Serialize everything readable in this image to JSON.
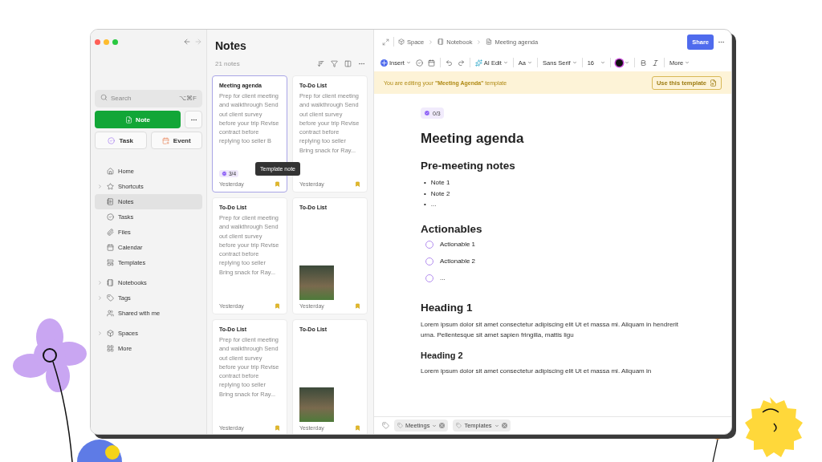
{
  "sidebar": {
    "search": {
      "placeholder": "Search",
      "shortcut": "⌥⌘F"
    },
    "note_button": "Note",
    "task_button": "Task",
    "event_button": "Event",
    "sections": [
      {
        "items": [
          {
            "label": "Home",
            "expandable": false,
            "selected": false
          },
          {
            "label": "Shortcuts",
            "expandable": true,
            "selected": false
          },
          {
            "label": "Notes",
            "expandable": false,
            "selected": true
          },
          {
            "label": "Tasks",
            "expandable": false,
            "selected": false
          },
          {
            "label": "Files",
            "expandable": false,
            "selected": false
          },
          {
            "label": "Calendar",
            "expandable": false,
            "selected": false
          },
          {
            "label": "Templates",
            "expandable": false,
            "selected": false
          }
        ]
      },
      {
        "items": [
          {
            "label": "Notebooks",
            "expandable": true,
            "selected": false
          },
          {
            "label": "Tags",
            "expandable": true,
            "selected": false
          },
          {
            "label": "Shared with me",
            "expandable": false,
            "selected": false
          }
        ]
      },
      {
        "items": [
          {
            "label": "Spaces",
            "expandable": true,
            "selected": false
          },
          {
            "label": "More",
            "expandable": false,
            "selected": false
          }
        ]
      }
    ]
  },
  "notes": {
    "title": "Notes",
    "count": "21 notes",
    "tooltip": "Template note",
    "cards": [
      {
        "title": "Meeting agenda",
        "preview": "Prep for client meeting and walkthrough Send out client survey before your trip Revise contract before replying too seller B",
        "image": false,
        "tasks": "3/4",
        "date": "Yesterday",
        "selected": true
      },
      {
        "title": "To-Do List",
        "preview": "Prep for client meeting and walkthrough Send out client survey before your trip Revise contract before replying too seller Bring snack for Ray...",
        "image": false,
        "date": "Yesterday",
        "selected": false
      },
      {
        "title": "To-Do List",
        "preview": "Prep for client meeting and walkthrough Send out client survey before your trip Revise contract before replying too seller Bring snack for Ray...",
        "image": false,
        "date": "Yesterday",
        "selected": false
      },
      {
        "title": "To-Do List",
        "image": true,
        "date": "Yesterday",
        "selected": false
      },
      {
        "title": "To-Do List",
        "preview": "Prep for client meeting and walkthrough Send out client survey before your trip Revise contract before replying too seller Bring snack for Ray...",
        "image": false,
        "date": "Yesterday",
        "selected": false
      },
      {
        "title": "To-Do List",
        "image": true,
        "date": "Yesterday",
        "selected": false
      }
    ]
  },
  "editor": {
    "breadcrumb": [
      "Space",
      "Notebook",
      "Meeting agenda"
    ],
    "share": "Share",
    "toolbar": {
      "insert": "Insert",
      "ai_edit": "AI Edit",
      "text_style": "Aa",
      "font": "Sans Serif",
      "size": "16",
      "more": "More"
    },
    "banner": {
      "text": "You are editing your **\"Meeting Agenda\"** template",
      "button": "Use this template"
    },
    "task_count": "0/3",
    "title": "Meeting agenda",
    "blocks": [
      {
        "kind": "heading",
        "text": "Pre-meeting notes"
      },
      {
        "kind": "bullets",
        "marker": "•",
        "items": [
          "Note 1",
          "Note 2",
          "..."
        ]
      },
      {
        "kind": "heading",
        "text": "Actionables"
      },
      {
        "kind": "todos",
        "items": [
          {
            "text": "Actionable 1",
            "checked": false
          },
          {
            "text": "Actionable 2",
            "checked": false
          },
          {
            "text": "...",
            "checked": false
          }
        ]
      },
      {
        "kind": "heading",
        "text": "Heading 1"
      },
      {
        "kind": "paragraph",
        "text": "Lorem ipsum dolor sit amet consectetur adipiscing elit Ut et massa mi. Aliquam in hendrerit urna. Pellentesque sit amet sapien fringilla, mattis ligu"
      },
      {
        "kind": "subheading",
        "text": "Heading 2"
      },
      {
        "kind": "paragraph",
        "text": "Lorem ipsum dolor sit amet consectetur adipiscing elit Ut et massa mi. Aliquam in"
      }
    ],
    "tags": [
      "Meetings",
      "Templates"
    ]
  }
}
